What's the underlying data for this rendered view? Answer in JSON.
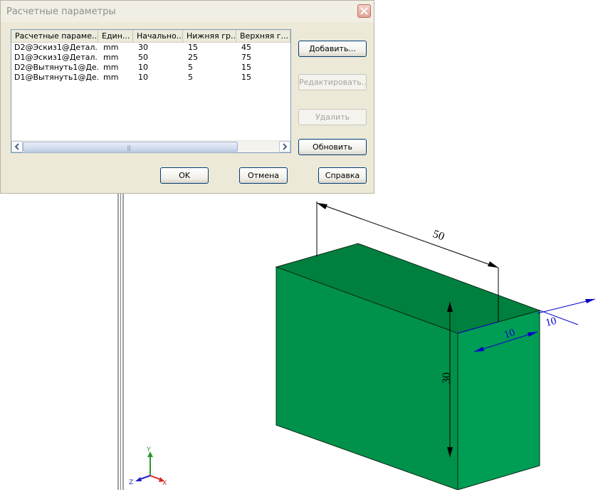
{
  "dialog": {
    "title": "Расчетные параметры",
    "columns": [
      "Расчетные параме...",
      "Един...",
      "Начально...",
      "Нижняя гр...",
      "Верхняя г..."
    ],
    "rows": [
      [
        "D2@Эскиз1@Детал...",
        "mm",
        "30",
        "15",
        "45"
      ],
      [
        "D1@Эскиз1@Детал...",
        "mm",
        "50",
        "25",
        "75"
      ],
      [
        "D2@Вытянуть1@Де...",
        "mm",
        "10",
        "5",
        "15"
      ],
      [
        "D1@Вытянуть1@Де...",
        "mm",
        "10",
        "5",
        "15"
      ]
    ],
    "buttons": {
      "add": "Добавить...",
      "edit": "Редактировать...",
      "delete": "Удалить",
      "update": "Обновить",
      "ok": "OK",
      "cancel": "Отмена",
      "help": "Справка"
    }
  },
  "model": {
    "dimensions": {
      "top": "50",
      "height": "30",
      "depth_a": "10",
      "depth_b": "10"
    },
    "colors": {
      "front": "#00914a",
      "top": "#007a3d",
      "side": "#009d55",
      "dim_black": "#000000",
      "dim_blue": "#0000cc"
    }
  },
  "triad": {
    "x": "X",
    "y": "Y",
    "z": "Z"
  }
}
